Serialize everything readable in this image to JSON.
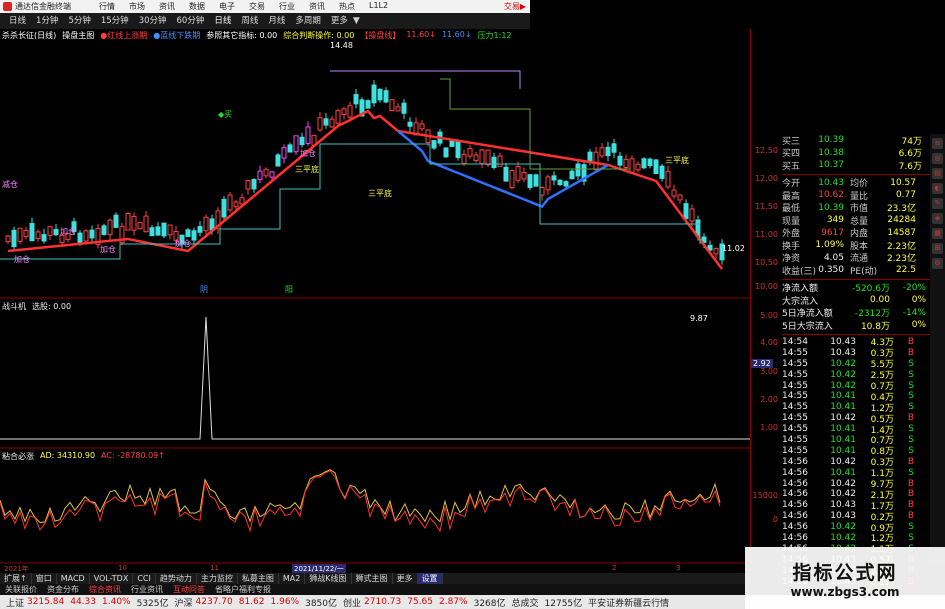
{
  "app": {
    "title": "通达信金融终端",
    "menu": [
      "行情",
      "市场",
      "资讯",
      "数据",
      "电子",
      "交易",
      "行业",
      "资讯",
      "热点",
      "L1L2"
    ],
    "trade_label": "交易▶"
  },
  "periods": [
    {
      "label": "日线",
      "caret": false
    },
    {
      "label": "1分钟",
      "caret": false
    },
    {
      "label": "5分钟",
      "caret": false
    },
    {
      "label": "15分钟",
      "caret": false
    },
    {
      "label": "30分钟",
      "caret": false
    },
    {
      "label": "60分钟",
      "caret": false
    },
    {
      "label": "日线",
      "caret": false
    },
    {
      "label": "周线",
      "caret": false
    },
    {
      "label": "月线",
      "caret": false
    },
    {
      "label": "多周期",
      "caret": false
    },
    {
      "label": "更多",
      "caret": true
    }
  ],
  "main_indicators": [
    {
      "text": "杀杀长征(日线)",
      "color": "#ffffff"
    },
    {
      "text": "操盘主图",
      "color": "#ffffff"
    },
    {
      "text": "●红线上涨期",
      "color": "#ff4040"
    },
    {
      "text": "●蓝线下跌期",
      "color": "#4090ff"
    },
    {
      "text": "参照其它指标: 0.00",
      "color": "#ffffff"
    },
    {
      "text": "综合判断操作: 0.00",
      "color": "#ffff40"
    },
    {
      "text": "【操盘线】",
      "color": "#ff4040"
    },
    {
      "text": "11.60↓",
      "color": "#ff4040"
    },
    {
      "text": "11.60↓",
      "color": "#4090ff"
    },
    {
      "text": "压力1:12",
      "color": "#21e021"
    }
  ],
  "sub1_label": {
    "name": "战斗机",
    "detail": "选股: 0.00"
  },
  "sub2_label": {
    "name": "粘合必涨",
    "ad": "AD: 34310.90",
    "ac": "AC: -28780.09↑"
  },
  "chart_annotations": {
    "high_price": "14.48",
    "low_price": "9.87",
    "right_price": "11.02",
    "three_flat": [
      "三平底",
      "三平底",
      "三平底"
    ],
    "buy_point": "◆买",
    "add_pos": [
      "加仓",
      "加仓",
      "加仓",
      "加仓",
      "加仓"
    ],
    "reduce": "减仓",
    "marker_a": "阴",
    "marker_b": "阳",
    "axis_highlight": "2.92"
  },
  "price_axis": [
    "12.50",
    "12.00",
    "11.50",
    "11.00",
    "10.50",
    "10.00"
  ],
  "sub1_axis": [
    "5.00",
    "4.00",
    "3.00",
    "2.00",
    "1.00"
  ],
  "sub2_axis": [
    "15000",
    "0"
  ],
  "quote": {
    "bids_top": [
      {
        "label": "买三",
        "price": "10.39",
        "vol": "74万"
      },
      {
        "label": "买四",
        "price": "10.38",
        "vol": "6.6万"
      },
      {
        "label": "买五",
        "price": "10.37",
        "vol": "7.6万"
      }
    ],
    "stats": [
      {
        "l1": "今开",
        "v1": "10.43",
        "l2": "均价",
        "v2": "10.57"
      },
      {
        "l1": "最高",
        "v1": "10.62",
        "l2": "量比",
        "v2": "0.77"
      },
      {
        "l1": "最低",
        "v1": "10.39",
        "l2": "市值",
        "v2": "23.3亿"
      },
      {
        "l1": "现量",
        "v1": "349",
        "l2": "总量",
        "v2": "24284"
      },
      {
        "l1": "外盘",
        "v1": "9617",
        "l2": "内盘",
        "v2": "14587"
      },
      {
        "l1": "换手",
        "v1": "1.09%",
        "l2": "股本",
        "v2": "2.23亿"
      },
      {
        "l1": "净资",
        "v1": "4.05",
        "l2": "流通",
        "v2": "2.23亿"
      },
      {
        "l1": "收益(三)",
        "v1": "0.350",
        "l2": "PE(动)",
        "v2": "22.5"
      }
    ],
    "flows": [
      {
        "label": "净流入额",
        "v1": "-520.6万",
        "v2": "-20%"
      },
      {
        "label": "大宗流入",
        "v1": "0.00",
        "v2": "0%"
      },
      {
        "label": "5日净流入额",
        "v1": "-2312万",
        "v2": "-14%"
      },
      {
        "label": "5日大宗流入",
        "v1": "10.8万",
        "v2": "0%"
      }
    ],
    "ticks": [
      {
        "time": "14:54",
        "price": "10.43",
        "vol": "4.3万",
        "dir": "B"
      },
      {
        "time": "14:55",
        "price": "10.43",
        "vol": "0.3万",
        "dir": "B"
      },
      {
        "time": "14:55",
        "price": "10.42",
        "vol": "5.5万",
        "dir": "S"
      },
      {
        "time": "14:55",
        "price": "10.42",
        "vol": "2.5万",
        "dir": "S"
      },
      {
        "time": "14:55",
        "price": "10.42",
        "vol": "0.7万",
        "dir": "S"
      },
      {
        "time": "14:55",
        "price": "10.41",
        "vol": "0.4万",
        "dir": "S"
      },
      {
        "time": "14:55",
        "price": "10.41",
        "vol": "1.2万",
        "dir": "S"
      },
      {
        "time": "14:55",
        "price": "10.42",
        "vol": "0.5万",
        "dir": "B"
      },
      {
        "time": "14:55",
        "price": "10.41",
        "vol": "1.4万",
        "dir": "S"
      },
      {
        "time": "14:55",
        "price": "10.41",
        "vol": "0.7万",
        "dir": "S"
      },
      {
        "time": "14:55",
        "price": "10.41",
        "vol": "0.8万",
        "dir": "S"
      },
      {
        "time": "14:56",
        "price": "10.42",
        "vol": "0.3万",
        "dir": "B"
      },
      {
        "time": "14:56",
        "price": "10.41",
        "vol": "1.1万",
        "dir": "S"
      },
      {
        "time": "14:56",
        "price": "10.42",
        "vol": "9.7万",
        "dir": "B"
      },
      {
        "time": "14:56",
        "price": "10.42",
        "vol": "2.1万",
        "dir": "B"
      },
      {
        "time": "14:56",
        "price": "10.43",
        "vol": "1.7万",
        "dir": "B"
      },
      {
        "time": "14:56",
        "price": "10.43",
        "vol": "0.2万",
        "dir": "B"
      },
      {
        "time": "14:56",
        "price": "10.42",
        "vol": "0.9万",
        "dir": "S"
      },
      {
        "time": "14:56",
        "price": "10.42",
        "vol": "1.2万",
        "dir": "S"
      },
      {
        "time": "14:56",
        "price": "10.42",
        "vol": "1.1万",
        "dir": "S"
      },
      {
        "time": "14:56",
        "price": "10.43",
        "vol": "0.5万",
        "dir": "B"
      },
      {
        "time": "14:56",
        "price": "10.43",
        "vol": "3.4万",
        "dir": "B"
      },
      {
        "time": "14:56",
        "price": "10.43",
        "vol": "0.1万",
        "dir": "B"
      }
    ],
    "mini_tag": "明显换手",
    "footer": "图文F10"
  },
  "date_axis": {
    "left": "2021年",
    "m1": "10",
    "m2": "11",
    "cursor": "2021/11/22/一",
    "m3": "2",
    "m4": "3"
  },
  "tabs": [
    "扩展↑",
    "窗口",
    "MACD",
    "VOL-TDX",
    "CCI",
    "趋势动力",
    "主力监控",
    "私募主图",
    "MA2",
    "狮战K线图",
    "狮式主图",
    "更多",
    "设置"
  ],
  "subtabs": [
    {
      "label": "关联报价",
      "red": false
    },
    {
      "label": "资金分布",
      "red": false
    },
    {
      "label": "综合资讯",
      "red": true
    },
    {
      "label": "行业资讯",
      "red": false
    },
    {
      "label": "互动问答",
      "red": true
    },
    {
      "label": "省略户福利专报",
      "red": false
    }
  ],
  "status": [
    {
      "name": "上证",
      "val": "3215.84",
      "chg": "44.33",
      "pct": "1.40%",
      "amt": "5325亿"
    },
    {
      "name": "沪深",
      "val": "4237.70",
      "chg": "81.62",
      "pct": "1.96%",
      "amt": "3850亿"
    },
    {
      "name": "创业",
      "val": "2710.73",
      "chg": "75.65",
      "pct": "2.87%",
      "amt": "3268亿"
    }
  ],
  "status_tail": {
    "label": "总成交",
    "amt": "12755亿",
    "note": "平安证券新疆云行情"
  },
  "watermark": {
    "title": "指标公式网",
    "url": "www.zbgs3.com"
  },
  "right_labels": {
    "r1": "11.02",
    "model": "模板"
  }
}
